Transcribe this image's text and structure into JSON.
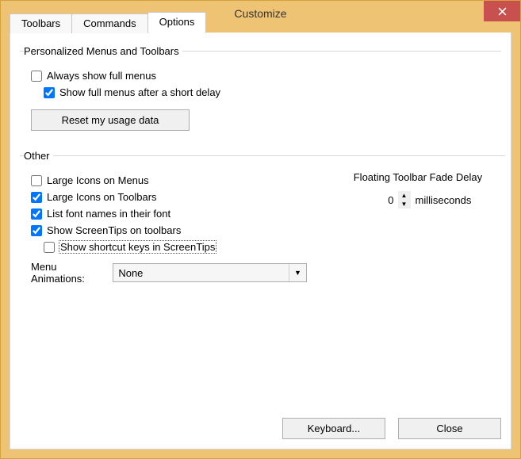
{
  "window": {
    "title": "Customize"
  },
  "tabs": {
    "toolbars": "Toolbars",
    "commands": "Commands",
    "options": "Options"
  },
  "group1": {
    "legend": "Personalized Menus and Toolbars",
    "always_full_menus": "Always show full menus",
    "short_delay": "Show full menus after a short delay",
    "reset_btn": "Reset my usage data"
  },
  "group2": {
    "legend": "Other",
    "large_icons_menus": "Large Icons on Menus",
    "large_icons_toolbars": "Large Icons on Toolbars",
    "list_font_names": "List font names in their font",
    "screentips": "Show ScreenTips on toolbars",
    "shortcut_keys": "Show shortcut keys in ScreenTips",
    "fade_label": "Floating Toolbar Fade Delay",
    "fade_value": "0",
    "fade_unit": "milliseconds",
    "menu_anim_label": "Menu Animations:",
    "menu_anim_value": "None"
  },
  "values": {
    "always_full_menus": false,
    "short_delay": true,
    "large_icons_menus": false,
    "large_icons_toolbars": true,
    "list_font_names": true,
    "screentips": true,
    "shortcut_keys": false
  },
  "footer": {
    "keyboard": "Keyboard...",
    "close": "Close"
  }
}
